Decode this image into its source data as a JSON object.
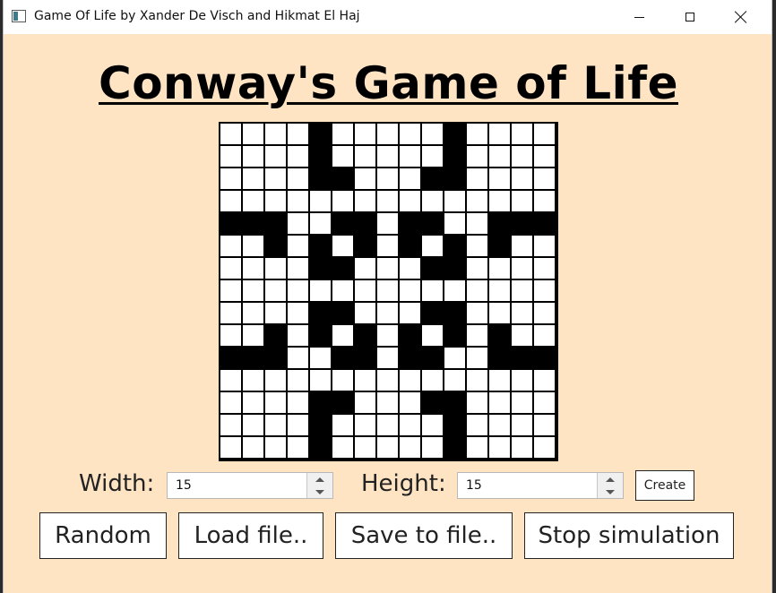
{
  "window": {
    "title": "Game Of Life by Xander De Visch and Hikmat El Haj",
    "icon": "app-window-icon"
  },
  "heading": "Conway's Game of Life",
  "grid": {
    "rows": [
      "....#.....#....",
      "....#.....#....",
      "....##...##....",
      "...............",
      "###..##.##..###",
      "..#.#.#.#.#.#..",
      "....##...##....",
      "...............",
      "....##...##....",
      "..#.#.#.#.#.#..",
      "###..##.##..###",
      "...............",
      "....##...##....",
      "....#.....#....",
      "....#.....#...."
    ]
  },
  "controls": {
    "width_label": "Width:",
    "width_value": "15",
    "height_label": "Height:",
    "height_value": "15",
    "create_label": "Create"
  },
  "buttons": {
    "random": "Random",
    "load": "Load file..",
    "save": "Save to file..",
    "stop": "Stop simulation"
  },
  "colors": {
    "background": "#ffe4c4",
    "alive": "#000000",
    "dead": "#ffffff"
  }
}
